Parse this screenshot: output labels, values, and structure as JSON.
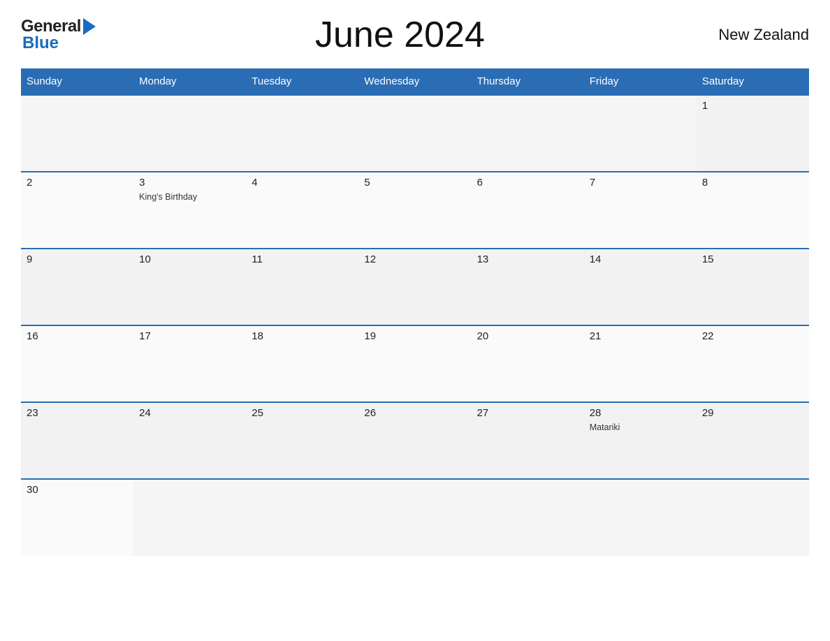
{
  "header": {
    "title": "June 2024",
    "country": "New Zealand",
    "logo_general": "General",
    "logo_blue": "Blue"
  },
  "days_of_week": [
    "Sunday",
    "Monday",
    "Tuesday",
    "Wednesday",
    "Thursday",
    "Friday",
    "Saturday"
  ],
  "weeks": [
    [
      {
        "date": "",
        "holiday": ""
      },
      {
        "date": "",
        "holiday": ""
      },
      {
        "date": "",
        "holiday": ""
      },
      {
        "date": "",
        "holiday": ""
      },
      {
        "date": "",
        "holiday": ""
      },
      {
        "date": "",
        "holiday": ""
      },
      {
        "date": "1",
        "holiday": ""
      }
    ],
    [
      {
        "date": "2",
        "holiday": ""
      },
      {
        "date": "3",
        "holiday": "King's Birthday"
      },
      {
        "date": "4",
        "holiday": ""
      },
      {
        "date": "5",
        "holiday": ""
      },
      {
        "date": "6",
        "holiday": ""
      },
      {
        "date": "7",
        "holiday": ""
      },
      {
        "date": "8",
        "holiday": ""
      }
    ],
    [
      {
        "date": "9",
        "holiday": ""
      },
      {
        "date": "10",
        "holiday": ""
      },
      {
        "date": "11",
        "holiday": ""
      },
      {
        "date": "12",
        "holiday": ""
      },
      {
        "date": "13",
        "holiday": ""
      },
      {
        "date": "14",
        "holiday": ""
      },
      {
        "date": "15",
        "holiday": ""
      }
    ],
    [
      {
        "date": "16",
        "holiday": ""
      },
      {
        "date": "17",
        "holiday": ""
      },
      {
        "date": "18",
        "holiday": ""
      },
      {
        "date": "19",
        "holiday": ""
      },
      {
        "date": "20",
        "holiday": ""
      },
      {
        "date": "21",
        "holiday": ""
      },
      {
        "date": "22",
        "holiday": ""
      }
    ],
    [
      {
        "date": "23",
        "holiday": ""
      },
      {
        "date": "24",
        "holiday": ""
      },
      {
        "date": "25",
        "holiday": ""
      },
      {
        "date": "26",
        "holiday": ""
      },
      {
        "date": "27",
        "holiday": ""
      },
      {
        "date": "28",
        "holiday": "Matariki"
      },
      {
        "date": "29",
        "holiday": ""
      }
    ],
    [
      {
        "date": "30",
        "holiday": ""
      },
      {
        "date": "",
        "holiday": ""
      },
      {
        "date": "",
        "holiday": ""
      },
      {
        "date": "",
        "holiday": ""
      },
      {
        "date": "",
        "holiday": ""
      },
      {
        "date": "",
        "holiday": ""
      },
      {
        "date": "",
        "holiday": ""
      }
    ]
  ]
}
